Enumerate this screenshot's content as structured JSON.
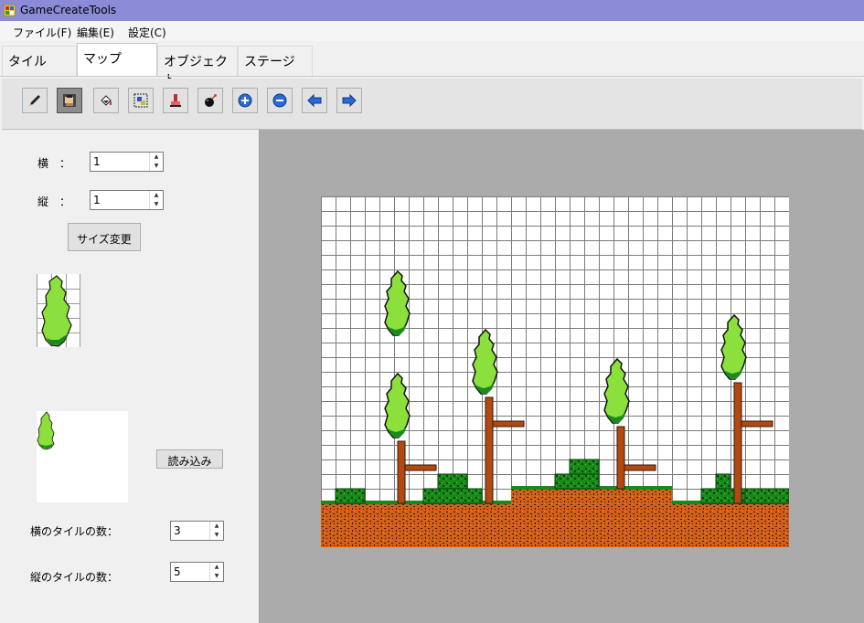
{
  "window": {
    "title": "GameCreateTools"
  },
  "menu": {
    "file": "ファイル(F)",
    "edit": "編集(E)",
    "settings": "設定(C)"
  },
  "tabs": {
    "tile": "タイル",
    "map": "マップ",
    "object": "オブジェクト",
    "stage": "ステージ",
    "active": "map"
  },
  "toolbar": {
    "tools": [
      "pencil-icon",
      "stamp-icon",
      "fill-icon",
      "select-icon",
      "eraser-icon",
      "bomb-icon",
      "zoom-in-icon",
      "zoom-out-icon",
      "arrow-left-icon",
      "arrow-right-icon"
    ],
    "selected": "stamp-icon"
  },
  "size": {
    "width_label": "横　：",
    "width_value": "1",
    "height_label": "縦　：",
    "height_value": "1",
    "resize_button": "サイズ変更"
  },
  "tileset": {
    "load_button": "読み込み",
    "cols_label": "横のタイルの数：",
    "cols_value": "3",
    "rows_label": "縦のタイルの数：",
    "rows_value": "5"
  },
  "colors": {
    "titlebar": "#8b8bd8",
    "leaf": "#8be03c",
    "leaf_dark": "#1c8a1c",
    "trunk": "#b14a12",
    "dirt": "#d2601a",
    "grass": "#178a17",
    "canvas_bg": "#ababab"
  }
}
